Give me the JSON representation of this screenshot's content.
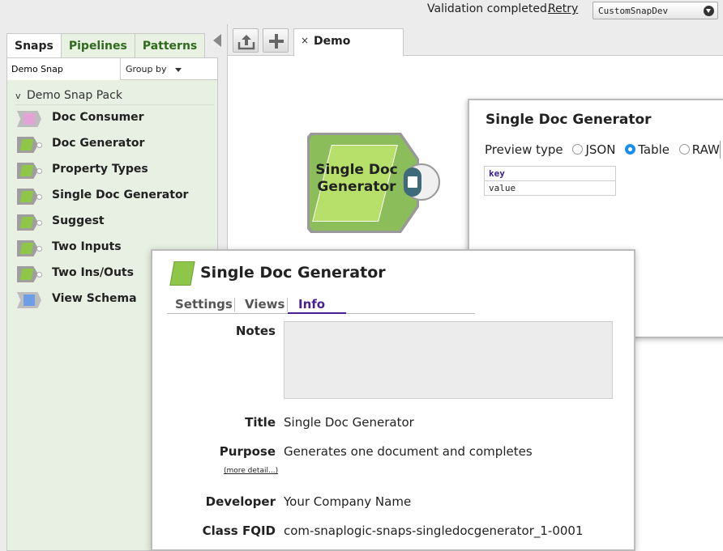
{
  "topbar": {
    "validation_text": "Validation completed.",
    "retry_label": "Retry",
    "org_select_value": "CustomSnapDev"
  },
  "left_panel": {
    "tabs": [
      {
        "label": "Snaps",
        "active": true
      },
      {
        "label": "Pipelines",
        "active": false
      },
      {
        "label": "Patterns",
        "active": false
      }
    ],
    "search_value": "Demo Snap",
    "group_by_label": "Group by",
    "pack_name": "Demo Snap Pack",
    "pack_caret": "v",
    "snaps": [
      {
        "label": "Doc Consumer",
        "icon": "consumer-snap-icon"
      },
      {
        "label": "Doc Generator",
        "icon": "generator-snap-icon"
      },
      {
        "label": "Property Types",
        "icon": "generator-snap-icon"
      },
      {
        "label": "Single Doc Generator",
        "icon": "generator-snap-icon"
      },
      {
        "label": "Suggest",
        "icon": "generator-snap-icon"
      },
      {
        "label": "Two Inputs",
        "icon": "generator-snap-icon"
      },
      {
        "label": "Two Ins/Outs",
        "icon": "generator-snap-icon"
      },
      {
        "label": "View Schema",
        "icon": "schema-snap-icon"
      }
    ]
  },
  "canvas": {
    "tab_close": "×",
    "tab_label": "Demo",
    "snap_node_title_line1": "Single Doc",
    "snap_node_title_line2": "Generator"
  },
  "preview": {
    "title": "Single Doc Generator",
    "type_label": "Preview type",
    "options": [
      "JSON",
      "Table",
      "RAW"
    ],
    "selected": "Table",
    "table_key": "key",
    "table_value": "value"
  },
  "settings_dialog": {
    "title": "Single Doc Generator",
    "tabs": [
      "Settings",
      "Views",
      "Info"
    ],
    "active_tab": "Info",
    "notes_label": "Notes",
    "notes_value": "",
    "title_label": "Title",
    "title_value": "Single Doc Generator",
    "purpose_label": "Purpose",
    "purpose_value": "Generates one document and completes",
    "more_detail": "(more detail...)",
    "developer_label": "Developer",
    "developer_value": "Your Company Name",
    "class_fqid_label": "Class FQID",
    "class_fqid_value": "com-snaplogic-snaps-singledocgenerator_1-0001"
  },
  "colors": {
    "brand_green": "#2f6b1f",
    "snap_green": "#8ec64a",
    "active_tab_purple": "#4b1f8f",
    "radio_selected": "#1a8ef0"
  }
}
